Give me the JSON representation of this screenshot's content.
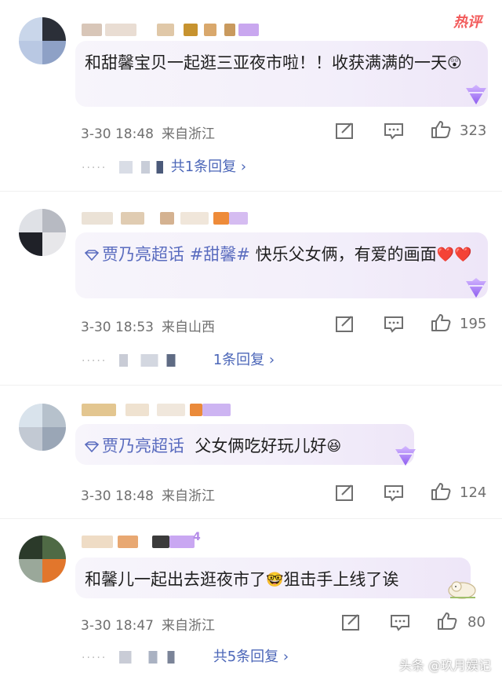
{
  "hot_badge": "热评",
  "comments": [
    {
      "text": "和甜馨宝贝一起逛三亚夜市啦！！收获满满的一天",
      "emoji": "😲",
      "date": "3-30 18:48",
      "location": "来自浙江",
      "likes": "323",
      "reply": "共1条回复"
    },
    {
      "topic1": "贾乃亮超话",
      "topic2": "#甜馨#",
      "text": "快乐父女俩，有爱的画面",
      "emoji": "❤️❤️",
      "date": "3-30 18:53",
      "location": "来自山西",
      "likes": "195",
      "reply": "1条回复"
    },
    {
      "topic1": "贾乃亮超话",
      "text": "父女俩吃好玩儿好",
      "emoji": "😆",
      "date": "3-30 18:48",
      "location": "来自浙江",
      "likes": "124"
    },
    {
      "text": "和馨儿一起出去逛夜市了",
      "emoji": "🤓",
      "text2": "狙击手上线了诶",
      "date": "3-30 18:47",
      "location": "来自浙江",
      "likes": "80",
      "reply": "共5条回复",
      "level_badge": "4"
    }
  ],
  "watermark": "头条 @玖月娱记",
  "colors": {
    "link": "#4b66b8",
    "hot": "#f25b5b",
    "meta": "#6f6f6f"
  }
}
